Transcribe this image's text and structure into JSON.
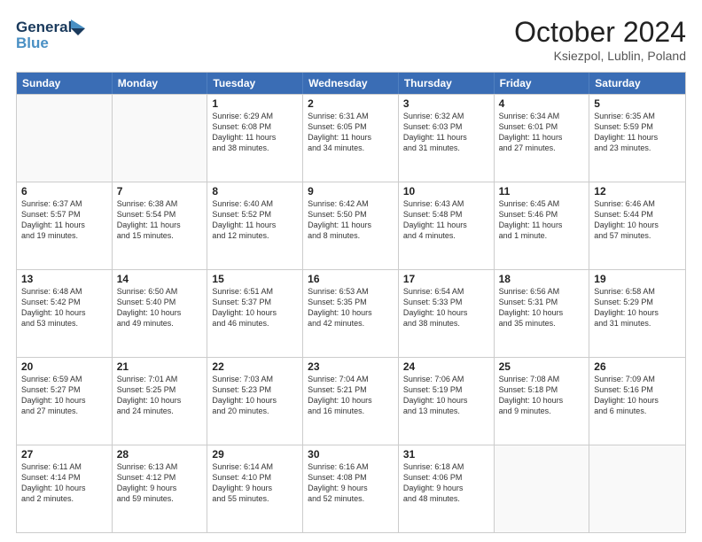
{
  "header": {
    "logo_general": "General",
    "logo_blue": "Blue",
    "title": "October 2024",
    "location": "Ksiezpol, Lublin, Poland"
  },
  "weekdays": [
    "Sunday",
    "Monday",
    "Tuesday",
    "Wednesday",
    "Thursday",
    "Friday",
    "Saturday"
  ],
  "rows": [
    [
      {
        "day": "",
        "lines": []
      },
      {
        "day": "",
        "lines": []
      },
      {
        "day": "1",
        "lines": [
          "Sunrise: 6:29 AM",
          "Sunset: 6:08 PM",
          "Daylight: 11 hours",
          "and 38 minutes."
        ]
      },
      {
        "day": "2",
        "lines": [
          "Sunrise: 6:31 AM",
          "Sunset: 6:05 PM",
          "Daylight: 11 hours",
          "and 34 minutes."
        ]
      },
      {
        "day": "3",
        "lines": [
          "Sunrise: 6:32 AM",
          "Sunset: 6:03 PM",
          "Daylight: 11 hours",
          "and 31 minutes."
        ]
      },
      {
        "day": "4",
        "lines": [
          "Sunrise: 6:34 AM",
          "Sunset: 6:01 PM",
          "Daylight: 11 hours",
          "and 27 minutes."
        ]
      },
      {
        "day": "5",
        "lines": [
          "Sunrise: 6:35 AM",
          "Sunset: 5:59 PM",
          "Daylight: 11 hours",
          "and 23 minutes."
        ]
      }
    ],
    [
      {
        "day": "6",
        "lines": [
          "Sunrise: 6:37 AM",
          "Sunset: 5:57 PM",
          "Daylight: 11 hours",
          "and 19 minutes."
        ]
      },
      {
        "day": "7",
        "lines": [
          "Sunrise: 6:38 AM",
          "Sunset: 5:54 PM",
          "Daylight: 11 hours",
          "and 15 minutes."
        ]
      },
      {
        "day": "8",
        "lines": [
          "Sunrise: 6:40 AM",
          "Sunset: 5:52 PM",
          "Daylight: 11 hours",
          "and 12 minutes."
        ]
      },
      {
        "day": "9",
        "lines": [
          "Sunrise: 6:42 AM",
          "Sunset: 5:50 PM",
          "Daylight: 11 hours",
          "and 8 minutes."
        ]
      },
      {
        "day": "10",
        "lines": [
          "Sunrise: 6:43 AM",
          "Sunset: 5:48 PM",
          "Daylight: 11 hours",
          "and 4 minutes."
        ]
      },
      {
        "day": "11",
        "lines": [
          "Sunrise: 6:45 AM",
          "Sunset: 5:46 PM",
          "Daylight: 11 hours",
          "and 1 minute."
        ]
      },
      {
        "day": "12",
        "lines": [
          "Sunrise: 6:46 AM",
          "Sunset: 5:44 PM",
          "Daylight: 10 hours",
          "and 57 minutes."
        ]
      }
    ],
    [
      {
        "day": "13",
        "lines": [
          "Sunrise: 6:48 AM",
          "Sunset: 5:42 PM",
          "Daylight: 10 hours",
          "and 53 minutes."
        ]
      },
      {
        "day": "14",
        "lines": [
          "Sunrise: 6:50 AM",
          "Sunset: 5:40 PM",
          "Daylight: 10 hours",
          "and 49 minutes."
        ]
      },
      {
        "day": "15",
        "lines": [
          "Sunrise: 6:51 AM",
          "Sunset: 5:37 PM",
          "Daylight: 10 hours",
          "and 46 minutes."
        ]
      },
      {
        "day": "16",
        "lines": [
          "Sunrise: 6:53 AM",
          "Sunset: 5:35 PM",
          "Daylight: 10 hours",
          "and 42 minutes."
        ]
      },
      {
        "day": "17",
        "lines": [
          "Sunrise: 6:54 AM",
          "Sunset: 5:33 PM",
          "Daylight: 10 hours",
          "and 38 minutes."
        ]
      },
      {
        "day": "18",
        "lines": [
          "Sunrise: 6:56 AM",
          "Sunset: 5:31 PM",
          "Daylight: 10 hours",
          "and 35 minutes."
        ]
      },
      {
        "day": "19",
        "lines": [
          "Sunrise: 6:58 AM",
          "Sunset: 5:29 PM",
          "Daylight: 10 hours",
          "and 31 minutes."
        ]
      }
    ],
    [
      {
        "day": "20",
        "lines": [
          "Sunrise: 6:59 AM",
          "Sunset: 5:27 PM",
          "Daylight: 10 hours",
          "and 27 minutes."
        ]
      },
      {
        "day": "21",
        "lines": [
          "Sunrise: 7:01 AM",
          "Sunset: 5:25 PM",
          "Daylight: 10 hours",
          "and 24 minutes."
        ]
      },
      {
        "day": "22",
        "lines": [
          "Sunrise: 7:03 AM",
          "Sunset: 5:23 PM",
          "Daylight: 10 hours",
          "and 20 minutes."
        ]
      },
      {
        "day": "23",
        "lines": [
          "Sunrise: 7:04 AM",
          "Sunset: 5:21 PM",
          "Daylight: 10 hours",
          "and 16 minutes."
        ]
      },
      {
        "day": "24",
        "lines": [
          "Sunrise: 7:06 AM",
          "Sunset: 5:19 PM",
          "Daylight: 10 hours",
          "and 13 minutes."
        ]
      },
      {
        "day": "25",
        "lines": [
          "Sunrise: 7:08 AM",
          "Sunset: 5:18 PM",
          "Daylight: 10 hours",
          "and 9 minutes."
        ]
      },
      {
        "day": "26",
        "lines": [
          "Sunrise: 7:09 AM",
          "Sunset: 5:16 PM",
          "Daylight: 10 hours",
          "and 6 minutes."
        ]
      }
    ],
    [
      {
        "day": "27",
        "lines": [
          "Sunrise: 6:11 AM",
          "Sunset: 4:14 PM",
          "Daylight: 10 hours",
          "and 2 minutes."
        ]
      },
      {
        "day": "28",
        "lines": [
          "Sunrise: 6:13 AM",
          "Sunset: 4:12 PM",
          "Daylight: 9 hours",
          "and 59 minutes."
        ]
      },
      {
        "day": "29",
        "lines": [
          "Sunrise: 6:14 AM",
          "Sunset: 4:10 PM",
          "Daylight: 9 hours",
          "and 55 minutes."
        ]
      },
      {
        "day": "30",
        "lines": [
          "Sunrise: 6:16 AM",
          "Sunset: 4:08 PM",
          "Daylight: 9 hours",
          "and 52 minutes."
        ]
      },
      {
        "day": "31",
        "lines": [
          "Sunrise: 6:18 AM",
          "Sunset: 4:06 PM",
          "Daylight: 9 hours",
          "and 48 minutes."
        ]
      },
      {
        "day": "",
        "lines": []
      },
      {
        "day": "",
        "lines": []
      }
    ]
  ]
}
